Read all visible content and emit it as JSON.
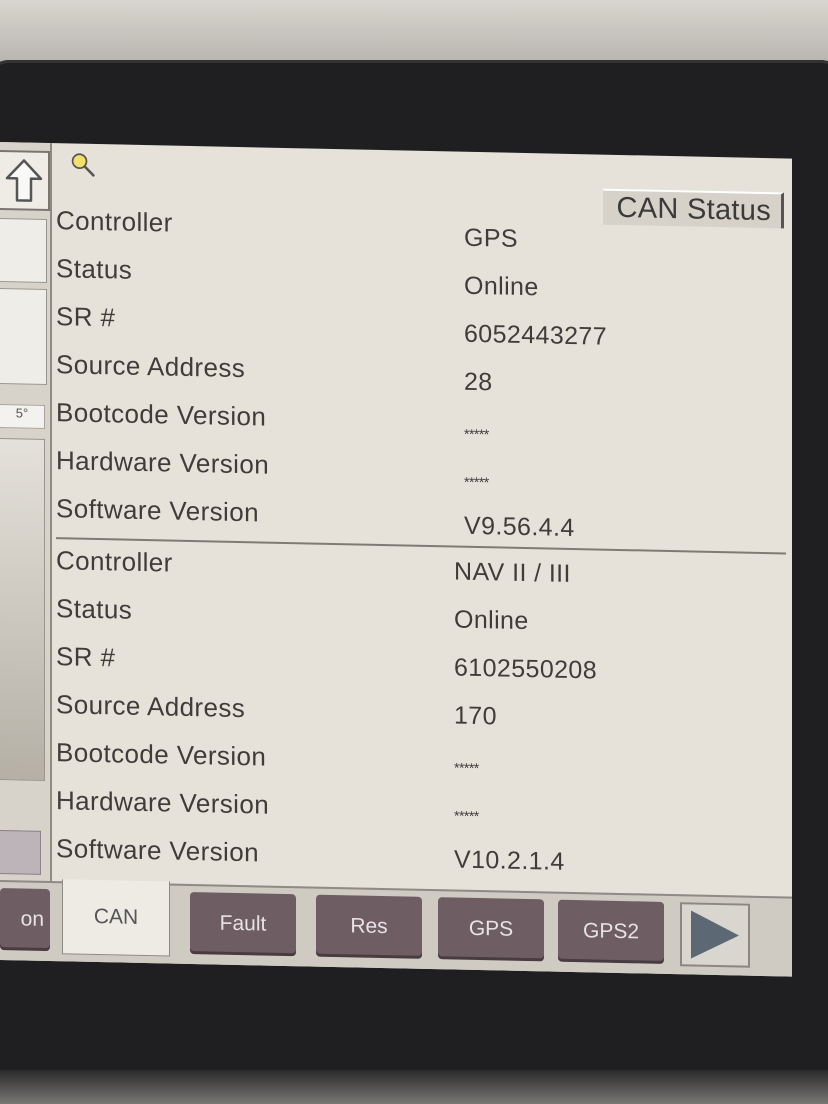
{
  "screen": {
    "title": "CAN Status"
  },
  "controllers": [
    {
      "rows": [
        {
          "label": "Controller",
          "value": "GPS"
        },
        {
          "label": "Status",
          "value": "Online"
        },
        {
          "label": "SR #",
          "value": "6052443277"
        },
        {
          "label": "Source Address",
          "value": "28"
        },
        {
          "label": "Bootcode Version",
          "value": "*****"
        },
        {
          "label": "Hardware Version",
          "value": "*****"
        },
        {
          "label": "Software Version",
          "value": "V9.56.4.4"
        }
      ]
    },
    {
      "rows": [
        {
          "label": "Controller",
          "value": "NAV II / III"
        },
        {
          "label": "Status",
          "value": "Online"
        },
        {
          "label": "SR #",
          "value": "6102550208"
        },
        {
          "label": "Source Address",
          "value": "170"
        },
        {
          "label": "Bootcode Version",
          "value": "*****"
        },
        {
          "label": "Hardware Version",
          "value": "*****"
        },
        {
          "label": "Software Version",
          "value": "V10.2.1.4"
        }
      ]
    }
  ],
  "left_panel": {
    "partial_label": "5°"
  },
  "tabs": [
    {
      "label": "on"
    },
    {
      "label": "CAN"
    },
    {
      "label": "Fault"
    },
    {
      "label": "Res"
    },
    {
      "label": "GPS"
    },
    {
      "label": "GPS2"
    }
  ],
  "colors": {
    "screen_bg": "#e6e2d9",
    "tab_bg": "#6f5d64",
    "tab_active_bg": "#eeebe4",
    "arrow": "#5c6874"
  },
  "icons": {
    "up": "up-arrow-icon",
    "diagnostics": "magnifier-icon",
    "next": "next-arrow-icon"
  }
}
